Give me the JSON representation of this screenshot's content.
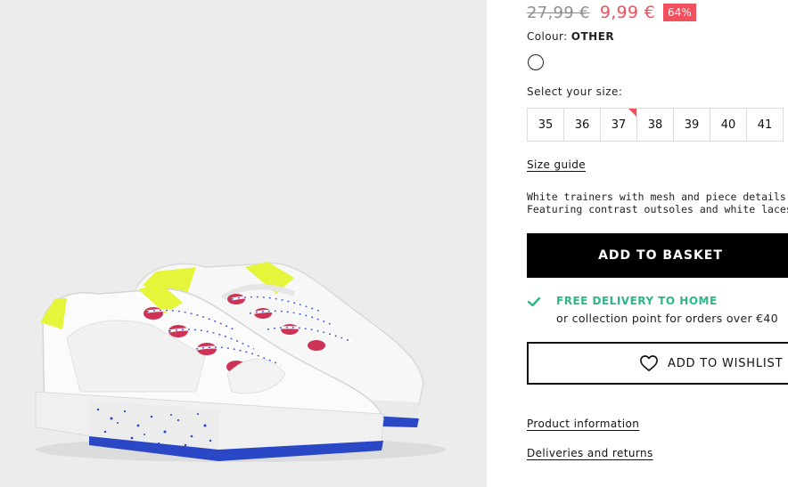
{
  "product": {
    "old_price": "27,99 €",
    "new_price": "9,99 €",
    "discount": "64%",
    "colour_label": "Colour:",
    "colour_value": "OTHER",
    "size_label": "Select your size:",
    "sizes": [
      "35",
      "36",
      "37",
      "38",
      "39",
      "40",
      "41"
    ],
    "size_with_marker": "37",
    "size_guide": "Size guide",
    "description_line1": "White trainers with mesh and piece details in differe",
    "description_line2": "Featuring contrast outsoles and white laces with blu",
    "add_to_basket": "ADD TO BASKET",
    "delivery_title": "FREE DELIVERY TO HOME",
    "delivery_sub": "or collection point for orders over €40",
    "add_to_wishlist": "ADD TO WISHLIST",
    "product_information": "Product information",
    "deliveries_returns": "Deliveries and returns"
  },
  "colors": {
    "sale": "#f0505c",
    "delivery": "#2bb78a",
    "image_bg": "#ececec"
  },
  "icons": {
    "check": "check-icon",
    "heart": "heart-icon",
    "swatch": "colour-swatch"
  }
}
